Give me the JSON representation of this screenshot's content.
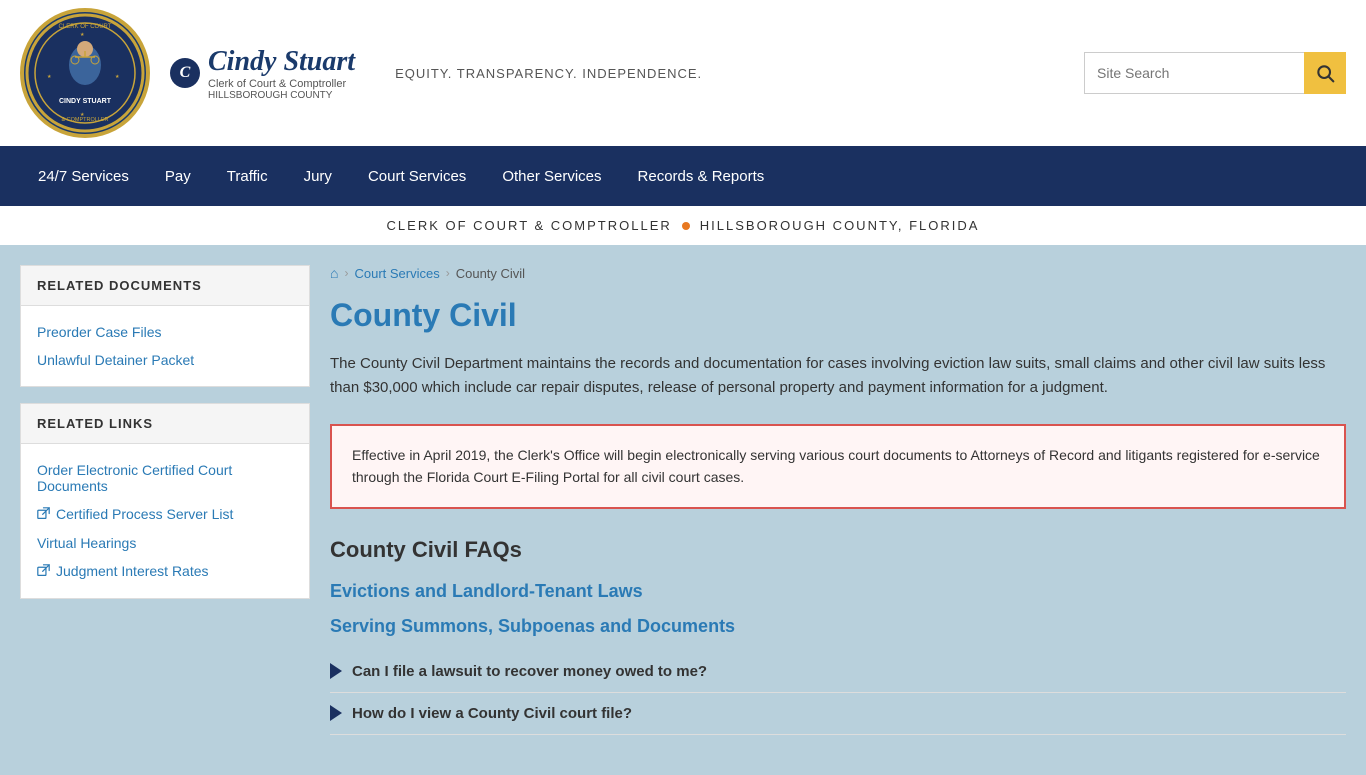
{
  "header": {
    "logo_alt": "Clerk of Court Hillsborough County",
    "brand_name": "Cindy Stuart",
    "brand_title": "Clerk of Court & Comptroller",
    "brand_county": "HILLSBOROUGH COUNTY",
    "tagline": "EQUITY. TRANSPARENCY. INDEPENDENCE.",
    "search_placeholder": "Site Search"
  },
  "nav": {
    "items": [
      {
        "label": "24/7 Services"
      },
      {
        "label": "Pay"
      },
      {
        "label": "Traffic"
      },
      {
        "label": "Jury"
      },
      {
        "label": "Court Services"
      },
      {
        "label": "Other Services"
      },
      {
        "label": "Records & Reports"
      }
    ]
  },
  "sub_header": {
    "left": "CLERK OF COURT & COMPTROLLER",
    "right": "HILLSBOROUGH COUNTY, FLORIDA"
  },
  "breadcrumb": {
    "home_label": "Home",
    "items": [
      "Court Services",
      "County Civil"
    ]
  },
  "page": {
    "title": "County Civil",
    "description": "The County Civil Department maintains the records and documentation for cases involving eviction law suits, small claims and other civil law suits less than $30,000 which include car repair disputes, release of personal property and payment information for a judgment.",
    "notice": "Effective in April 2019, the Clerk's Office will begin electronically serving various court documents to Attorneys of Record and litigants registered for e-service through the Florida Court E-Filing Portal for all civil court cases.",
    "faq_title": "County Civil FAQs",
    "faq_sections": [
      {
        "title": "Evictions and Landlord-Tenant Laws"
      },
      {
        "title": "Serving Summons, Subpoenas and Documents"
      }
    ],
    "faq_questions": [
      {
        "question": "Can I file a lawsuit to recover money owed to me?"
      },
      {
        "question": "How do I view a County Civil court file?"
      }
    ]
  },
  "sidebar": {
    "related_documents": {
      "title": "RELATED DOCUMENTS",
      "links": [
        {
          "label": "Preorder Case Files",
          "external": false
        },
        {
          "label": "Unlawful Detainer Packet",
          "external": false
        }
      ]
    },
    "related_links": {
      "title": "RELATED LINKS",
      "links": [
        {
          "label": "Order Electronic Certified Court Documents",
          "external": false
        },
        {
          "label": "Certified Process Server List",
          "external": true
        },
        {
          "label": "Virtual Hearings",
          "external": false
        },
        {
          "label": "Judgment Interest Rates",
          "external": true
        }
      ]
    }
  }
}
